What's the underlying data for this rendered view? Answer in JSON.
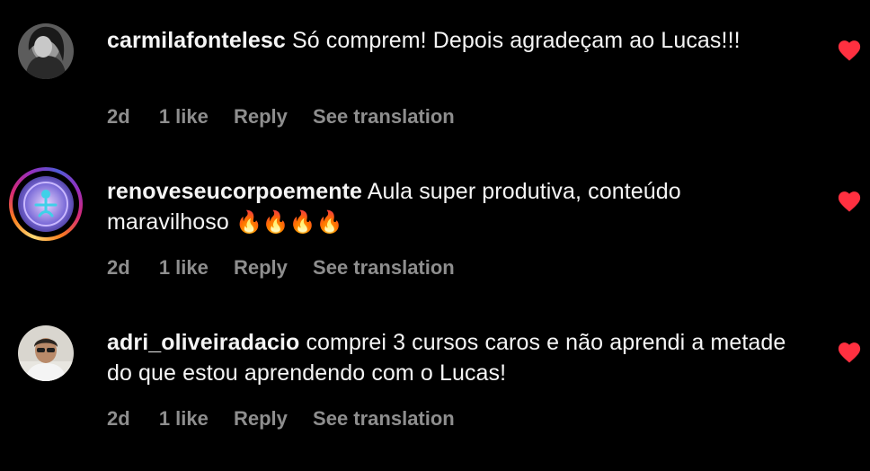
{
  "colors": {
    "background": "#000000",
    "text": "#f5f5f5",
    "meta": "#8e8e8e",
    "heart": "#ff3040"
  },
  "comments": [
    {
      "username": "carmilafontelesc",
      "text": "Só comprem! Depois agradeçam ao Lucas!!!",
      "time": "2d",
      "likes": "1 like",
      "reply": "Reply",
      "translate": "See translation",
      "liked_icon": "heart-filled-icon",
      "has_story_ring": false
    },
    {
      "username": "renoveseucorpoemente",
      "text": "Aula super produtiva, conteúdo maravilhoso",
      "emojis": "🔥🔥🔥🔥",
      "time": "2d",
      "likes": "1 like",
      "reply": "Reply",
      "translate": "See translation",
      "liked_icon": "heart-filled-icon",
      "has_story_ring": true
    },
    {
      "username": "adri_oliveiradacio",
      "text": "comprei 3 cursos caros e não aprendi a metade do que estou aprendendo com o Lucas!",
      "time": "2d",
      "likes": "1 like",
      "reply": "Reply",
      "translate": "See translation",
      "liked_icon": "heart-filled-icon",
      "has_story_ring": false
    }
  ]
}
